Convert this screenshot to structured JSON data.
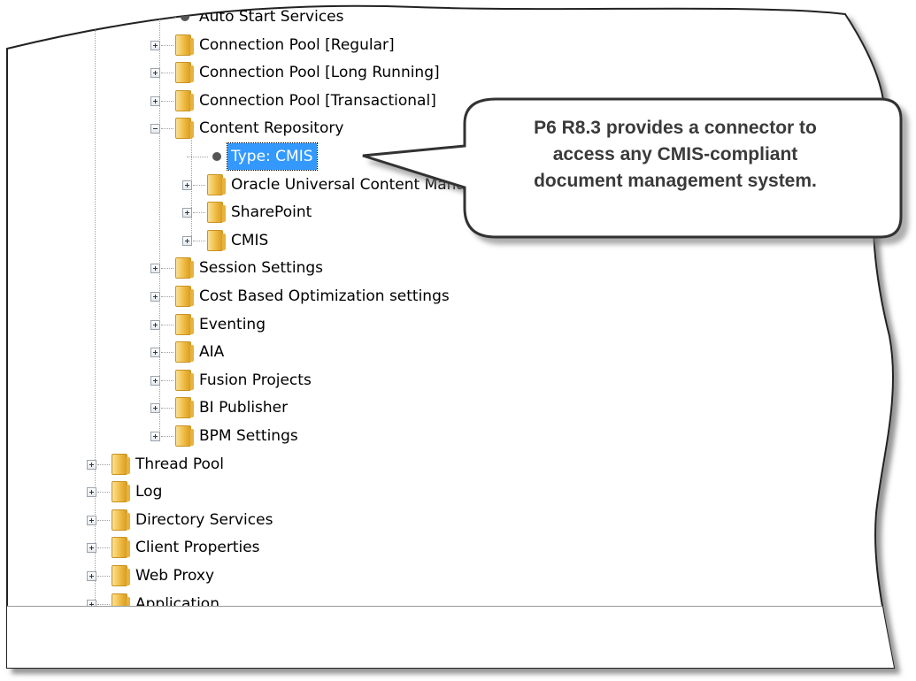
{
  "tree": {
    "items": [
      {
        "label": "Auto Start Services",
        "kind": "leaf",
        "level": 2
      },
      {
        "label": "Connection Pool [Regular]",
        "kind": "folder",
        "level": 2,
        "expanded": false
      },
      {
        "label": "Connection Pool [Long Running]",
        "kind": "folder",
        "level": 2,
        "expanded": false
      },
      {
        "label": "Connection Pool [Transactional]",
        "kind": "folder",
        "level": 2,
        "expanded": false
      },
      {
        "label": "Content Repository",
        "kind": "folder",
        "level": 2,
        "expanded": true
      },
      {
        "label": "Type: CMIS",
        "kind": "leaf",
        "level": 3,
        "selected": true
      },
      {
        "label": "Oracle Universal Content Management",
        "kind": "folder",
        "level": 3,
        "expanded": false
      },
      {
        "label": "SharePoint",
        "kind": "folder",
        "level": 3,
        "expanded": false
      },
      {
        "label": "CMIS",
        "kind": "folder",
        "level": 3,
        "expanded": false
      },
      {
        "label": "Session Settings",
        "kind": "folder",
        "level": 2,
        "expanded": false
      },
      {
        "label": "Cost Based Optimization settings",
        "kind": "folder",
        "level": 2,
        "expanded": false
      },
      {
        "label": "Eventing",
        "kind": "folder",
        "level": 2,
        "expanded": false
      },
      {
        "label": "AIA",
        "kind": "folder",
        "level": 2,
        "expanded": false
      },
      {
        "label": "Fusion Projects",
        "kind": "folder",
        "level": 2,
        "expanded": false
      },
      {
        "label": "BI Publisher",
        "kind": "folder",
        "level": 2,
        "expanded": false
      },
      {
        "label": "BPM Settings",
        "kind": "folder",
        "level": 2,
        "expanded": false
      },
      {
        "label": "Thread Pool",
        "kind": "folder",
        "level": 1,
        "expanded": false
      },
      {
        "label": "Log",
        "kind": "folder",
        "level": 1,
        "expanded": false
      },
      {
        "label": "Directory Services",
        "kind": "folder",
        "level": 1,
        "expanded": false
      },
      {
        "label": "Client Properties",
        "kind": "folder",
        "level": 1,
        "expanded": false
      },
      {
        "label": "Web Proxy",
        "kind": "folder",
        "level": 1,
        "expanded": false
      },
      {
        "label": "Application",
        "kind": "folder",
        "level": 1,
        "expanded": false
      }
    ]
  },
  "callout": {
    "line1": "P6 R8.3 provides a connector to",
    "line2": "access any CMIS-compliant",
    "line3": "document management system."
  },
  "colors": {
    "selection": "#3399ff",
    "folder": "#f3c24e",
    "callout_border": "#333333",
    "callout_text": "#3a3a3a"
  },
  "icons": {
    "folder": "folder-icon",
    "leaf": "bullet-icon",
    "expand": "plus-expander-icon",
    "collapse": "minus-expander-icon"
  }
}
